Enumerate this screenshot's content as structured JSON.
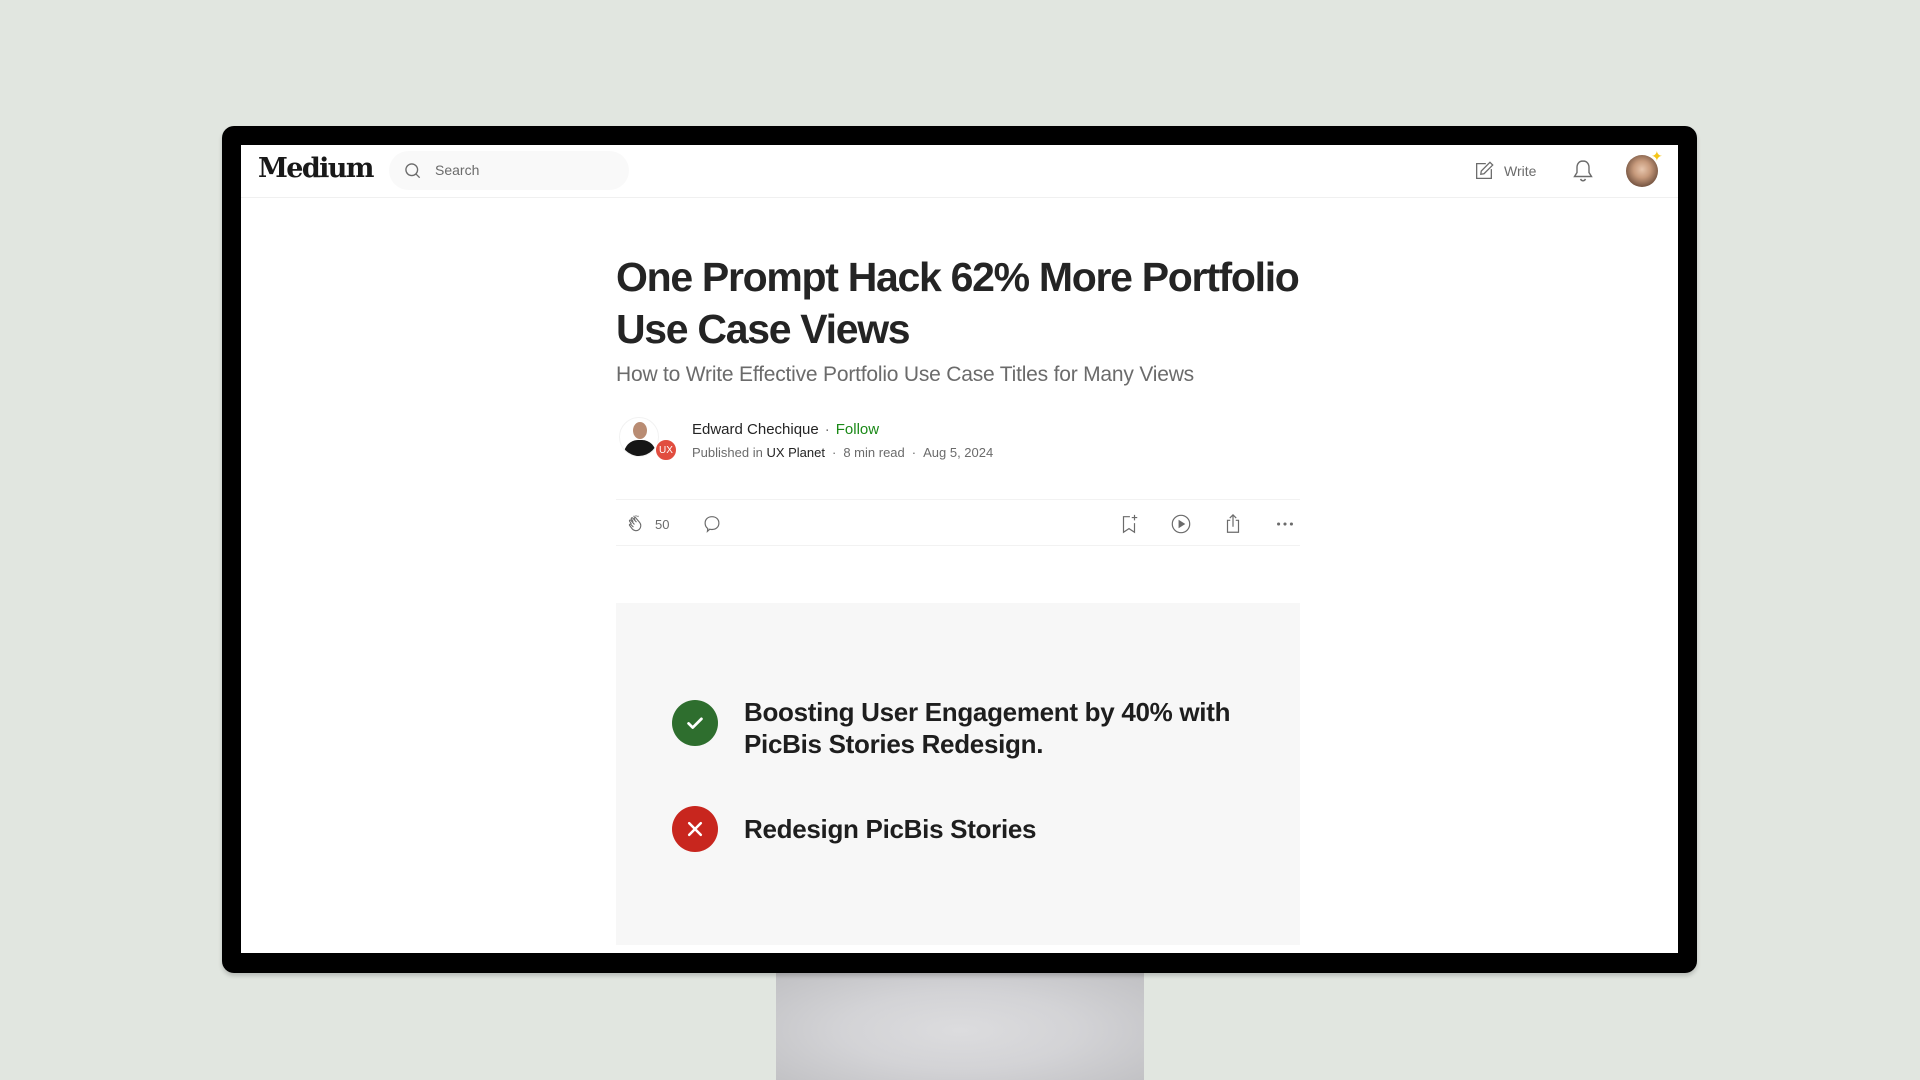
{
  "nav": {
    "logo": "Medium",
    "search_placeholder": "Search",
    "write_label": "Write",
    "icons": {
      "search": "search-icon",
      "write": "pencil-square-icon",
      "notifications": "bell-icon",
      "avatar": "user-avatar"
    }
  },
  "article": {
    "title": "One Prompt Hack 62% More Portfolio Use Case Views",
    "subtitle": "How to Write Effective Portfolio Use Case Titles for Many Views",
    "author": {
      "name": "Edward Chechique",
      "follow_label": "Follow",
      "published_prefix": "Published in",
      "publication": "UX Planet",
      "publication_badge": "UX",
      "read_time": "8 min read",
      "date": "Aug 5, 2024"
    },
    "actions": {
      "claps": "50",
      "items": [
        "clap",
        "comment",
        "save",
        "listen",
        "share",
        "more"
      ]
    },
    "figure": {
      "items": [
        {
          "status": "good",
          "text": "Boosting User Engagement by 40% with PicBis Stories Redesign.",
          "color": "#2e6e2e"
        },
        {
          "status": "bad",
          "text": "Redesign PicBis Stories",
          "color": "#c8261e"
        }
      ]
    }
  },
  "colors": {
    "background": "#e1e6e0",
    "follow_green": "#1a8917",
    "badge_red": "#e14d3f"
  }
}
